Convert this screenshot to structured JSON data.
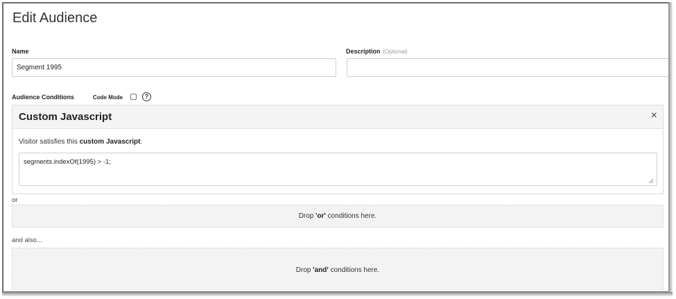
{
  "page": {
    "title": "Edit Audience"
  },
  "name": {
    "label": "Name",
    "value": "Segment 1995"
  },
  "description": {
    "label": "Description",
    "optional": "(Optional)",
    "value": ""
  },
  "conditions": {
    "label": "Audience Conditions",
    "code_mode_label": "Code Mode",
    "code_mode_checked": false,
    "help_glyph": "?"
  },
  "custom_js": {
    "title": "Custom Javascript",
    "close_glyph": "×",
    "sentence_prefix": "Visitor satisfies this ",
    "sentence_bold": "custom Javascript",
    "sentence_suffix": ":",
    "code": "segments.indexOf(1995) > -1;"
  },
  "or_section": {
    "label": "or",
    "drop_prefix": "Drop ",
    "drop_bold": "'or'",
    "drop_suffix": " conditions here."
  },
  "and_section": {
    "label": "and also...",
    "drop_prefix": "Drop ",
    "drop_bold": "'and'",
    "drop_suffix": " conditions here."
  },
  "icons": {
    "help": "help-circle-icon",
    "close": "close-icon",
    "resize": "resize-grip-icon"
  }
}
